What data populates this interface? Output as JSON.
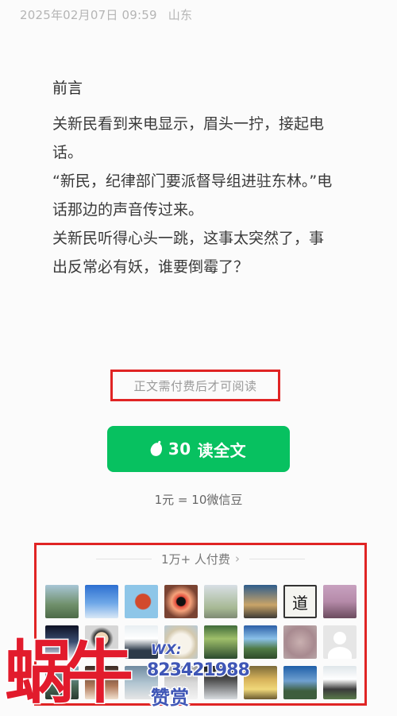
{
  "post_meta": {
    "date": "2025年02月07日 09:59",
    "location": "山东"
  },
  "article": {
    "preface_title": "前言",
    "lines": [
      "关新民看到来电显示，眉头一拧，接起电话。",
      "“新民，纪律部门要派督导组进驻东林。”电话那边的声音传过来。",
      "关新民听得心头一跳，这事太突然了，事出反常必有妖，谁要倒霉了？"
    ]
  },
  "paywall": {
    "notice": "正文需付费后才可阅读",
    "button_price": "30",
    "button_label": "读全文",
    "exchange_rate": "1元 = 10微信豆"
  },
  "payers": {
    "header": "1万+ 人付费",
    "avatar_char": "道",
    "avatar_count": 24
  },
  "watermark": {
    "logo_text": "蜗牛",
    "wx_label": "WX:",
    "wx_id": "823421988",
    "sub_text": "赞赏"
  },
  "colors": {
    "accent_green": "#07c160",
    "highlight_red": "#e02424",
    "watermark_blue": "#3f56b6"
  }
}
